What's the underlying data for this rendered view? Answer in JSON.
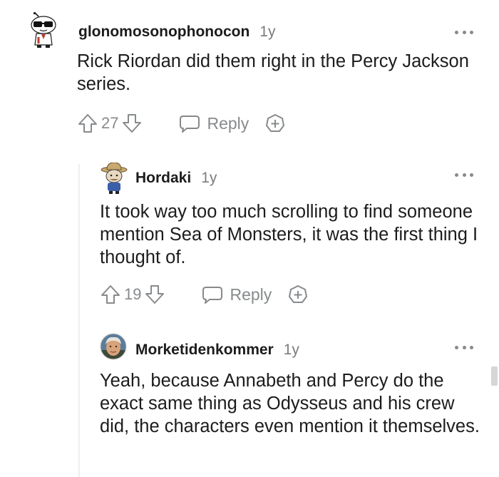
{
  "comments": [
    {
      "username": "glonomosonophonocon",
      "age": "1y",
      "text": "Rick Riordan did them right in the Percy Jackson series.",
      "votes": "27",
      "reply_label": "Reply"
    },
    {
      "username": "Hordaki",
      "age": "1y",
      "text": "It took way too much scrolling to find someone mention Sea of Monsters, it was the first thing I thought of.",
      "votes": "19",
      "reply_label": "Reply"
    },
    {
      "username": "Morketidenkommer",
      "age": "1y",
      "text": "Yeah, because Annabeth and Percy do the exact same thing as Odysseus and his crew did, the characters even mention it themselves."
    }
  ],
  "icons": {
    "upvote": "arrow-up-icon",
    "downvote": "arrow-down-icon",
    "reply": "speech-bubble-icon",
    "award": "award-plus-icon",
    "more": "more-options-icon"
  },
  "colors": {
    "text": "#1c1c1c",
    "muted": "#878a8c",
    "thread_line": "#edeff1"
  }
}
